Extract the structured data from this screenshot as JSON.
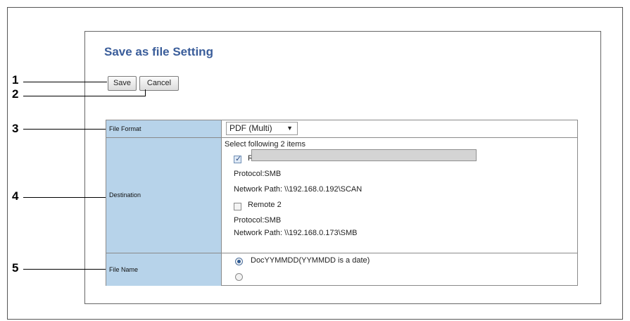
{
  "page": {
    "title": "Save as file Setting"
  },
  "toolbar": {
    "save_label": "Save",
    "cancel_label": "Cancel"
  },
  "callouts": [
    "1",
    "2",
    "3",
    "4",
    "5"
  ],
  "table": {
    "file_format": {
      "label": "File Format",
      "value": "PDF (Multi)",
      "arrow": "▼"
    },
    "destination": {
      "label": "Destination",
      "intro": "Select following 2 items",
      "remote1": {
        "name": "Remote 1",
        "checked": true,
        "protocol": "Protocol:SMB",
        "path": "Network Path: \\\\192.168.0.192\\SCAN"
      },
      "remote2": {
        "name": "Remote 2",
        "checked": false,
        "protocol": "Protocol:SMB",
        "path": "Network Path: \\\\192.168.0.173\\SMB"
      }
    },
    "file_name": {
      "label": "File Name",
      "option1": "DocYYMMDD(YYMMDD is a date)",
      "custom_value": ""
    }
  },
  "colors": {
    "title_blue": "#3a5d9a",
    "label_bg": "#b7d3ea"
  }
}
